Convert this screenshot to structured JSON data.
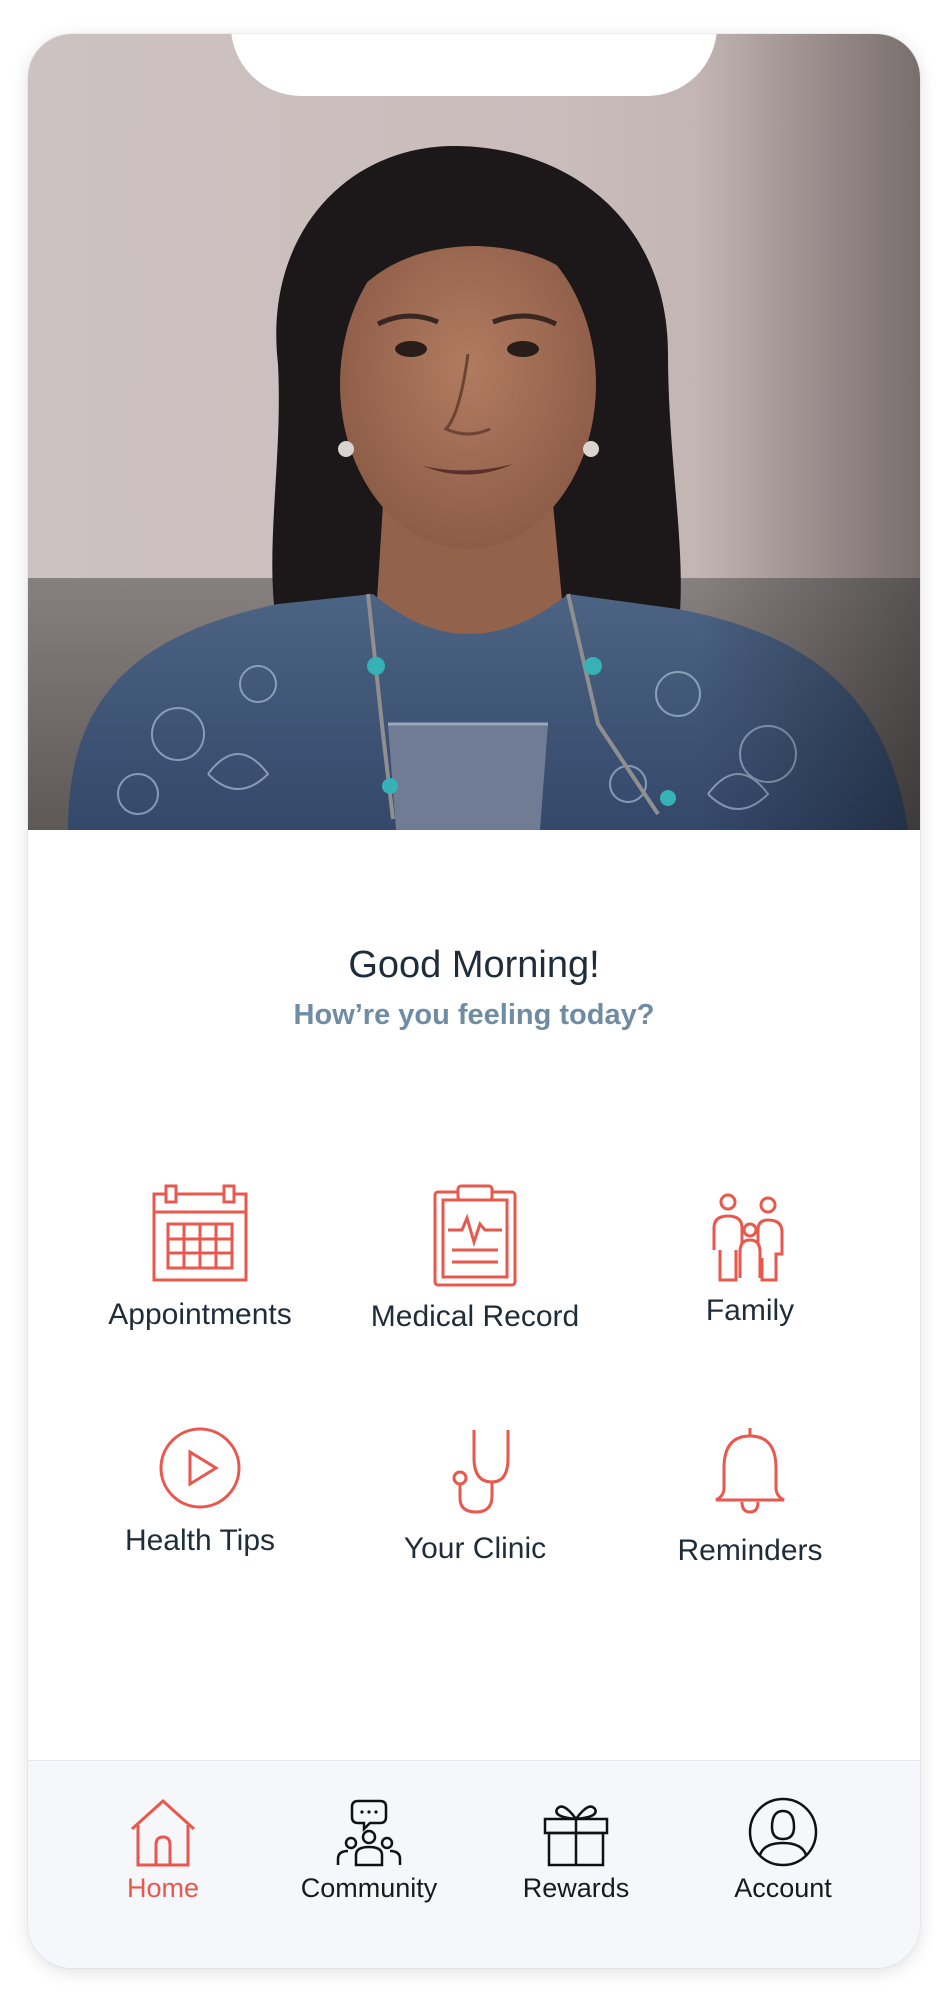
{
  "greeting": {
    "title": "Good Morning!",
    "subtitle": "How’re you feeling today?"
  },
  "tiles": [
    {
      "label": "Appointments",
      "icon": "calendar-icon"
    },
    {
      "label": "Medical Record",
      "icon": "clipboard-icon"
    },
    {
      "label": "Family",
      "icon": "family-icon"
    },
    {
      "label": "Health Tips",
      "icon": "play-icon"
    },
    {
      "label": "Your Clinic",
      "icon": "stethoscope-icon"
    },
    {
      "label": "Reminders",
      "icon": "bell-icon"
    }
  ],
  "nav": {
    "active": "Home",
    "items": [
      {
        "label": "Home",
        "icon": "home-icon"
      },
      {
        "label": "Community",
        "icon": "community-icon"
      },
      {
        "label": "Rewards",
        "icon": "gift-icon"
      },
      {
        "label": "Account",
        "icon": "account-icon"
      }
    ]
  },
  "colors": {
    "accent": "#e8584c",
    "text_dark": "#1f2d3a",
    "text_muted": "#6e8ca4",
    "nav_background": "#f5f7fb"
  }
}
